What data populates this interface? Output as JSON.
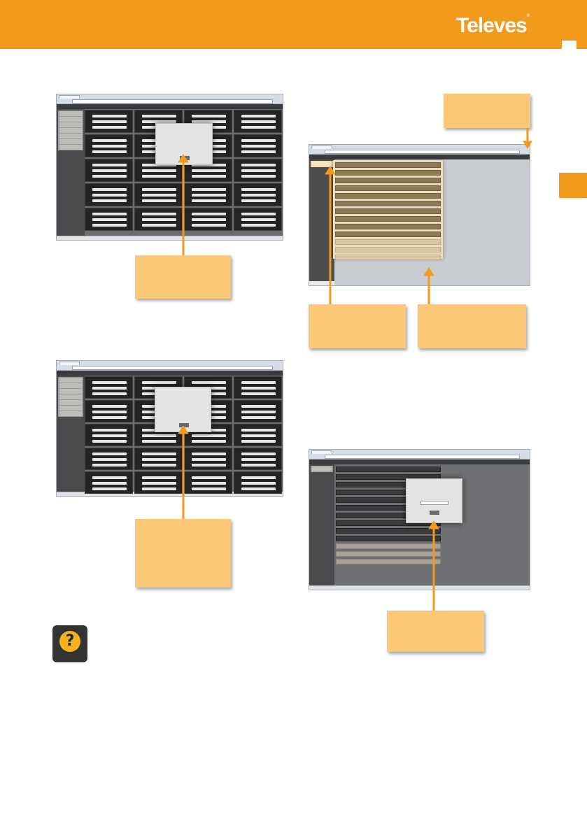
{
  "header": {
    "brand": "Televes",
    "brand_color": "#f29a1b"
  },
  "icons": [
    "question-mark-icon"
  ],
  "colors": {
    "accent": "#f29a1b",
    "callout": "#fbc877",
    "app_dark": "#3b3b3d"
  }
}
